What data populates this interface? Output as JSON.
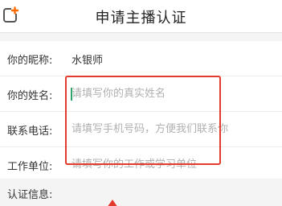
{
  "header": {
    "title": "申请主播认证",
    "back_icon": "back-edit-icon",
    "accent_color": "#ff6a00"
  },
  "form": {
    "nickname": {
      "label": "你的昵称:",
      "value": "水银师"
    },
    "name": {
      "label": "你的姓名:",
      "placeholder": "请填写你的真实姓名"
    },
    "phone": {
      "label": "联系电话:",
      "placeholder": "请填写手机号码，方便我们联系你"
    },
    "work": {
      "label": "工作单位:",
      "placeholder": "请填写你的工作或学习单位"
    }
  },
  "info": {
    "label": "认证信息:"
  },
  "annotation": {
    "color": "#e23a2c"
  }
}
